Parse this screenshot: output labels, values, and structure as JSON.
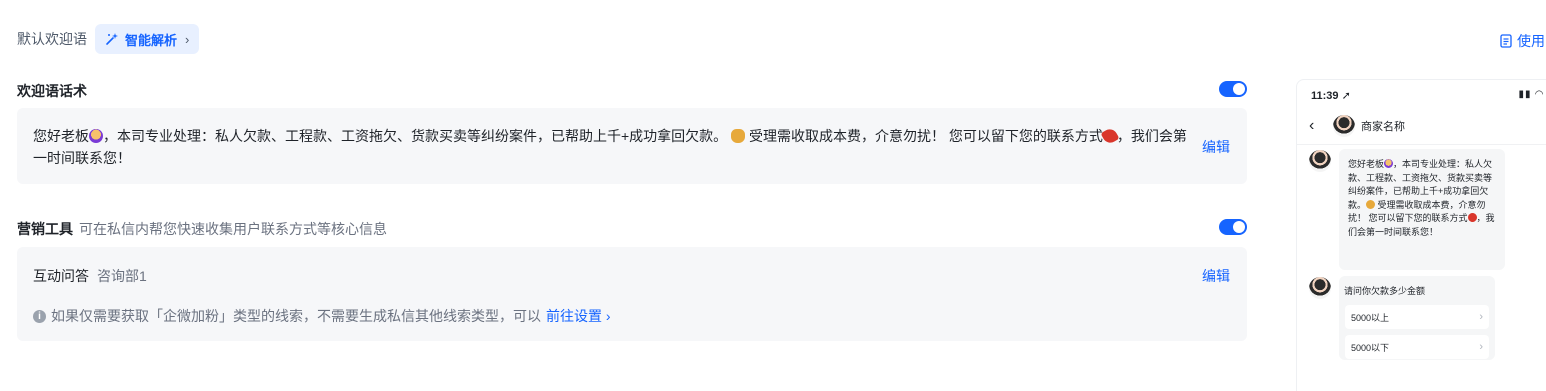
{
  "header": {
    "default_greeting_label": "默认欢迎语",
    "ai_parse_label": "智能解析",
    "use_label": "使用"
  },
  "welcome": {
    "title": "欢迎语话术",
    "text_part1": "您好老板",
    "text_part2": "，本司专业处理：私人欠款、工程款、工资拖欠、货款买卖等纠纷案件，已帮助上千+成功拿回欠款。",
    "text_part3": " 受理需收取成本费，介意勿扰！ 您可以留下您的联系方式",
    "text_part4": "，我们会第一时间联系您！",
    "edit_label": "编辑",
    "enabled": true
  },
  "marketing": {
    "title": "营销工具",
    "description": "可在私信内帮您快速收集用户联系方式等核心信息",
    "enabled": true,
    "tool_label": "互动问答",
    "tool_value": "咨询部1",
    "edit_label": "编辑",
    "hint_text": "如果仅需要获取「企微加粉」类型的线索，不需要生成私信其他线索类型，可以",
    "hint_link": "前往设置"
  },
  "preview": {
    "time": "11:39",
    "merchant_name": "商家名称",
    "bubble_part1": "您好老板",
    "bubble_part2": "，本司专业处理：私人欠款、工程款、工资拖欠、货款买卖等纠纷案件，已帮助上千+成功拿回欠款。",
    "bubble_part3": " 受理需收取成本费，介意勿扰！ 您可以留下您的联系方式",
    "bubble_part4": "，我们会第一时间联系您！",
    "question": "请问你欠款多少金额",
    "options": [
      "5000以上",
      "5000以下"
    ]
  },
  "colors": {
    "accent": "#1664ff",
    "panel_bg": "#f6f7f9",
    "chip_bg": "#e8f0ff"
  }
}
